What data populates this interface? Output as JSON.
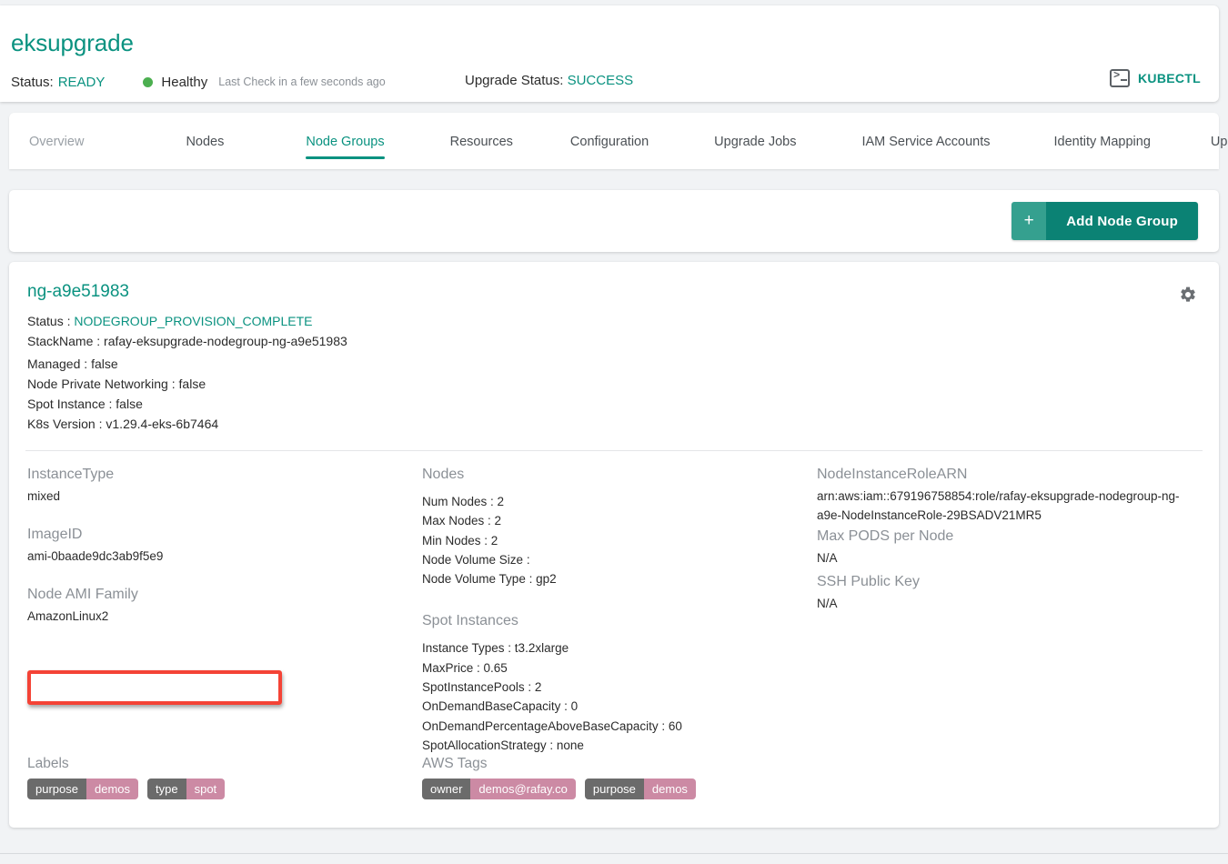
{
  "header": {
    "cluster_name": "eksupgrade",
    "status_label": "Status:",
    "status_value": "READY",
    "health_text": "Healthy",
    "health_dot_color": "#4caf50",
    "last_check": "Last Check in a few seconds ago",
    "upgrade_status_label": "Upgrade Status:",
    "upgrade_status_value": "SUCCESS",
    "kubectl_label": "KUBECTL",
    "accent_color": "#0a9280"
  },
  "tabs": [
    {
      "label": "Overview",
      "active": false,
      "muted": true
    },
    {
      "label": "Nodes",
      "active": false,
      "muted": false
    },
    {
      "label": "Node Groups",
      "active": true,
      "muted": false
    },
    {
      "label": "Resources",
      "active": false,
      "muted": false
    },
    {
      "label": "Configuration",
      "active": false,
      "muted": false
    },
    {
      "label": "Upgrade Jobs",
      "active": false,
      "muted": false
    },
    {
      "label": "IAM Service Accounts",
      "active": false,
      "muted": false
    },
    {
      "label": "Identity Mapping",
      "active": false,
      "muted": false
    },
    {
      "label": "Upgrade Insights",
      "active": false,
      "muted": false
    }
  ],
  "toolbar": {
    "add_node_group_plus": "+",
    "add_node_group_label": "Add Node Group"
  },
  "node_group": {
    "name": "ng-a9e51983",
    "meta": [
      {
        "key": "Status :",
        "value": "NODEGROUP_PROVISION_COMPLETE",
        "teal": true
      },
      {
        "key": "StackName :",
        "value": "rafay-eksupgrade-nodegroup-ng-a9e51983",
        "teal": false
      },
      {
        "key": "Managed :",
        "value": "false",
        "teal": false
      },
      {
        "key": "Node Private Networking :",
        "value": "false",
        "teal": false
      },
      {
        "key": "Spot Instance :",
        "value": "false",
        "teal": false
      },
      {
        "key": "K8s Version :",
        "value": "v1.29.4-eks-6b7464",
        "teal": false
      }
    ],
    "col1": {
      "instance_type_title": "InstanceType",
      "instance_type_value": "mixed",
      "image_id_title": "ImageID",
      "image_id_value": "ami-0baade9dc3ab9f5e9",
      "ami_family_title": "Node AMI Family",
      "ami_family_value": "AmazonLinux2"
    },
    "col2": {
      "nodes_title": "Nodes",
      "nodes_rows": [
        "Num Nodes : 2",
        "Max Nodes : 2",
        "Min Nodes : 2",
        "Node Volume Size :",
        "Node Volume Type :  gp2"
      ],
      "spot_title": "Spot Instances",
      "spot_rows": [
        "Instance Types :  t3.2xlarge",
        "MaxPrice :  0.65",
        "SpotInstancePools :  2",
        "OnDemandBaseCapacity :  0",
        "OnDemandPercentageAboveBaseCapacity :  60",
        "SpotAllocationStrategy :  none"
      ]
    },
    "col3": {
      "arn_title": "NodeInstanceRoleARN",
      "arn_value": "arn:aws:iam::679196758854:role/rafay-eksupgrade-nodegroup-ng-a9e-NodeInstanceRole-29BSADV21MR5",
      "max_pods_title": "Max PODS per Node",
      "max_pods_value": "N/A",
      "ssh_title": "SSH Public Key",
      "ssh_value": "N/A"
    },
    "labels_title": "Labels",
    "labels": [
      {
        "key": "purpose",
        "value": "demos"
      },
      {
        "key": "type",
        "value": "spot"
      }
    ],
    "aws_tags_title": "AWS Tags",
    "aws_tags": [
      {
        "key": "owner",
        "value": "demos@rafay.co"
      },
      {
        "key": "purpose",
        "value": "demos"
      }
    ],
    "chip_key_color": "#6b6b6b",
    "chip_value_color": "#cc8aa4",
    "gear_icon": "gear-icon"
  },
  "annotation": {
    "highlight_color": "#f44336",
    "highlight_target": "K8s Version : v1.29.4-eks-6b7464"
  }
}
